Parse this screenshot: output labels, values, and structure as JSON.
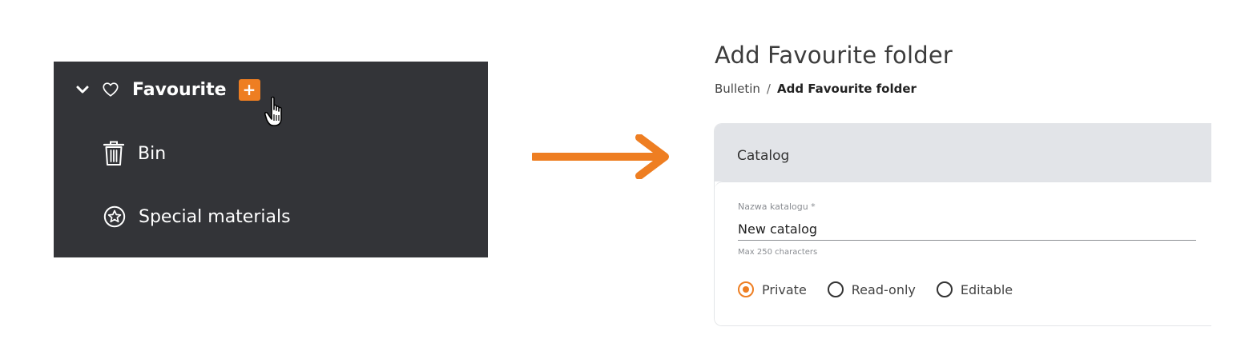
{
  "sidebar": {
    "favourite": {
      "label": "Favourite",
      "add_label": "+",
      "expanded": true
    },
    "items": [
      {
        "label": "Bin",
        "icon": "trash-icon"
      },
      {
        "label": "Special materials",
        "icon": "star-circle-icon"
      }
    ]
  },
  "form": {
    "title": "Add Favourite folder",
    "breadcrumb": {
      "root": "Bulletin",
      "separator": "/",
      "current": "Add Favourite folder"
    },
    "section_title": "Catalog",
    "name_field": {
      "label": "Nazwa katalogu *",
      "value": "New catalog",
      "hint": "Max 250 characters"
    },
    "access_options": [
      {
        "label": "Private",
        "checked": true
      },
      {
        "label": "Read-only",
        "checked": false
      },
      {
        "label": "Editable",
        "checked": false
      }
    ]
  },
  "colors": {
    "accent": "#ee7e22",
    "sidebar_bg": "#333438",
    "card_header_bg": "#e2e4e8"
  }
}
